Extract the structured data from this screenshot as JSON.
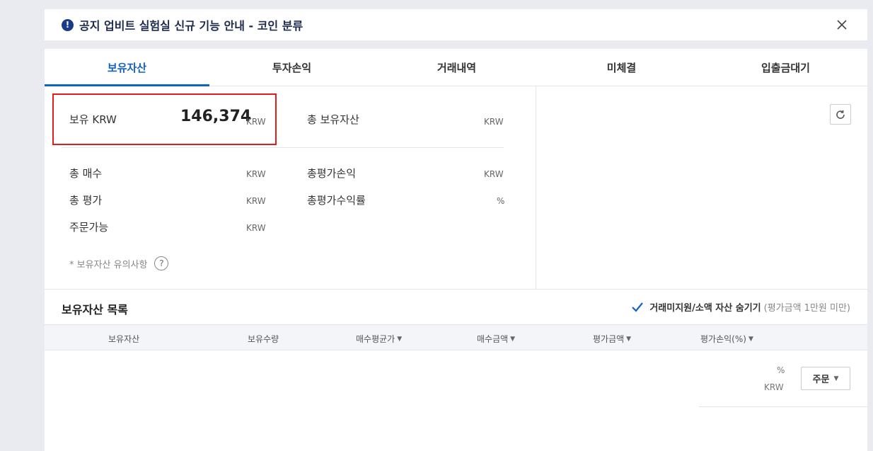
{
  "notice": {
    "text": "공지 업비트 실험실 신규 기능 안내 - 코인 분류"
  },
  "tabs": [
    "보유자산",
    "투자손익",
    "거래내역",
    "미체결",
    "입출금대기"
  ],
  "summary": {
    "krw_label": "보유 KRW",
    "krw_value": "146,374",
    "unit_krw": "KRW",
    "unit_pct": "%",
    "total_holding_label": "총 보유자산",
    "total_buy_label": "총 매수",
    "total_eval_label": "총 평가",
    "orderable_label": "주문가능",
    "total_pl_label": "총평가손익",
    "total_return_label": "총평가수익률",
    "caution": "* 보유자산 유의사항",
    "help_icon": "?"
  },
  "holdings": {
    "title": "보유자산 목록",
    "hide_label": "거래미지원/소액 자산 숨기기",
    "hide_sub": "(평가금액 1만원 미만)",
    "hide_checked": true,
    "columns": [
      "보유자산",
      "보유수량",
      "매수평균가",
      "매수금액",
      "평가금액",
      "평가손익(%)"
    ],
    "row": {
      "pct": "%",
      "krw": "KRW",
      "order": "주문"
    }
  },
  "colors": {
    "accent": "#1261c4",
    "highlight": "#e01e1e",
    "notice_icon": "#1b3a8a"
  }
}
